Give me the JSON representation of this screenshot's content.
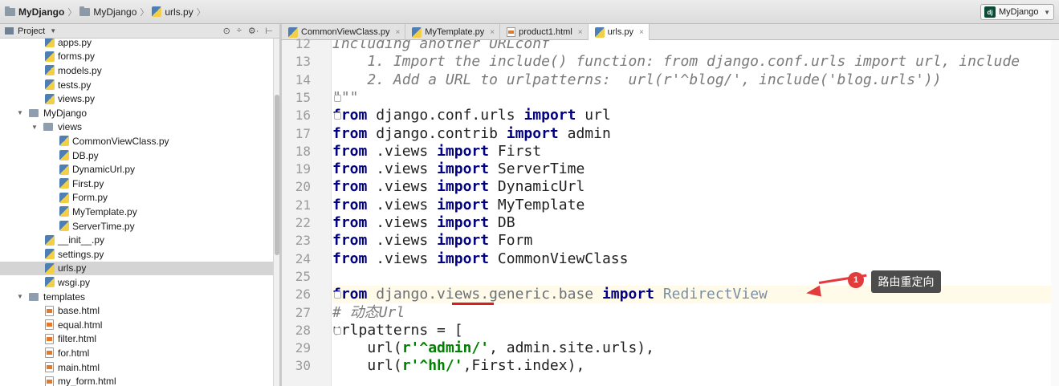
{
  "breadcrumb": {
    "project": "MyDjango",
    "folder": "MyDjango",
    "file": "urls.py"
  },
  "run_config": {
    "icon_text": "dj",
    "label": "MyDjango"
  },
  "project_panel": {
    "title": "Project",
    "tools": [
      "⊙",
      "÷",
      "⚙·",
      "⊢"
    ]
  },
  "tree": [
    {
      "label": "apps.py",
      "type": "py",
      "indent": 2
    },
    {
      "label": "forms.py",
      "type": "py",
      "indent": 2
    },
    {
      "label": "models.py",
      "type": "py",
      "indent": 2
    },
    {
      "label": "tests.py",
      "type": "py",
      "indent": 2
    },
    {
      "label": "views.py",
      "type": "py",
      "indent": 2
    },
    {
      "label": "MyDjango",
      "type": "folder",
      "indent": 1,
      "expanded": true
    },
    {
      "label": "views",
      "type": "folder",
      "indent": 2,
      "expanded": true
    },
    {
      "label": "CommonViewClass.py",
      "type": "py",
      "indent": 3
    },
    {
      "label": "DB.py",
      "type": "py",
      "indent": 3
    },
    {
      "label": "DynamicUrl.py",
      "type": "py",
      "indent": 3
    },
    {
      "label": "First.py",
      "type": "py",
      "indent": 3
    },
    {
      "label": "Form.py",
      "type": "py",
      "indent": 3
    },
    {
      "label": "MyTemplate.py",
      "type": "py",
      "indent": 3
    },
    {
      "label": "ServerTime.py",
      "type": "py",
      "indent": 3
    },
    {
      "label": "__init__.py",
      "type": "py",
      "indent": 2
    },
    {
      "label": "settings.py",
      "type": "py",
      "indent": 2
    },
    {
      "label": "urls.py",
      "type": "py",
      "indent": 2,
      "selected": true
    },
    {
      "label": "wsgi.py",
      "type": "py",
      "indent": 2
    },
    {
      "label": "templates",
      "type": "folder",
      "indent": 1,
      "expanded": true
    },
    {
      "label": "base.html",
      "type": "html",
      "indent": 2
    },
    {
      "label": "equal.html",
      "type": "html",
      "indent": 2
    },
    {
      "label": "filter.html",
      "type": "html",
      "indent": 2
    },
    {
      "label": "for.html",
      "type": "html",
      "indent": 2
    },
    {
      "label": "main.html",
      "type": "html",
      "indent": 2
    },
    {
      "label": "my_form.html",
      "type": "html",
      "indent": 2
    }
  ],
  "tabs": [
    {
      "label": "CommonViewClass.py",
      "type": "py"
    },
    {
      "label": "MyTemplate.py",
      "type": "py"
    },
    {
      "label": "product1.html",
      "type": "html"
    },
    {
      "label": "urls.py",
      "type": "py",
      "active": true
    }
  ],
  "editor": {
    "first_line_partial": "Including another URLconf",
    "line_numbers": [
      "12",
      "13",
      "14",
      "15",
      "16",
      "17",
      "18",
      "19",
      "20",
      "21",
      "22",
      "23",
      "24",
      "25",
      "26",
      "27",
      "28",
      "29",
      "30"
    ],
    "current_line": "26",
    "lines": [
      [
        {
          "t": "Including another URLconf",
          "c": "cm"
        }
      ],
      [
        {
          "t": "    1. Import the include() function: from django.conf.urls import url, include",
          "c": "cm"
        }
      ],
      [
        {
          "t": "    2. Add a URL to urlpatterns:  url(r'^blog/', include('blog.urls'))",
          "c": "cm"
        }
      ],
      [
        {
          "t": "\"\"\"",
          "c": "cm"
        }
      ],
      [
        {
          "t": "from",
          "c": "kw"
        },
        {
          "t": " django.conf.urls ",
          "c": ""
        },
        {
          "t": "import",
          "c": "kw"
        },
        {
          "t": " url",
          "c": ""
        }
      ],
      [
        {
          "t": "from",
          "c": "kw"
        },
        {
          "t": " django.contrib ",
          "c": ""
        },
        {
          "t": "import",
          "c": "kw"
        },
        {
          "t": " admin",
          "c": ""
        }
      ],
      [
        {
          "t": "from",
          "c": "kw"
        },
        {
          "t": " .views ",
          "c": ""
        },
        {
          "t": "import",
          "c": "kw"
        },
        {
          "t": " First",
          "c": ""
        }
      ],
      [
        {
          "t": "from",
          "c": "kw"
        },
        {
          "t": " .views ",
          "c": ""
        },
        {
          "t": "import",
          "c": "kw"
        },
        {
          "t": " ServerTime",
          "c": ""
        }
      ],
      [
        {
          "t": "from",
          "c": "kw"
        },
        {
          "t": " .views ",
          "c": ""
        },
        {
          "t": "import",
          "c": "kw"
        },
        {
          "t": " DynamicUrl",
          "c": ""
        }
      ],
      [
        {
          "t": "from",
          "c": "kw"
        },
        {
          "t": " .views ",
          "c": ""
        },
        {
          "t": "import",
          "c": "kw"
        },
        {
          "t": " MyTemplate",
          "c": ""
        }
      ],
      [
        {
          "t": "from",
          "c": "kw"
        },
        {
          "t": " .views ",
          "c": ""
        },
        {
          "t": "import",
          "c": "kw"
        },
        {
          "t": " DB",
          "c": ""
        }
      ],
      [
        {
          "t": "from",
          "c": "kw"
        },
        {
          "t": " .views ",
          "c": ""
        },
        {
          "t": "import",
          "c": "kw"
        },
        {
          "t": " Form",
          "c": ""
        }
      ],
      [
        {
          "t": "from",
          "c": "kw"
        },
        {
          "t": " .views ",
          "c": ""
        },
        {
          "t": "import",
          "c": "kw"
        },
        {
          "t": " CommonViewClass",
          "c": ""
        }
      ],
      [],
      [
        {
          "t": "from",
          "c": "kw"
        },
        {
          "t": " django.views.generic.base ",
          "c": "dim"
        },
        {
          "t": "import",
          "c": "kw"
        },
        {
          "t": " ",
          "c": ""
        },
        {
          "t": "RedirectView",
          "c": "unused"
        }
      ],
      [
        {
          "t": "# 动态Url",
          "c": "cm"
        }
      ],
      [
        {
          "t": "urlpatterns = [",
          "c": ""
        }
      ],
      [
        {
          "t": "    url(",
          "c": ""
        },
        {
          "t": "r'^admin/'",
          "c": "st"
        },
        {
          "t": ", admin.site.urls),",
          "c": ""
        }
      ],
      [
        {
          "t": "    url(",
          "c": ""
        },
        {
          "t": "r'^hh/'",
          "c": "st"
        },
        {
          "t": ",First.index),",
          "c": ""
        }
      ]
    ]
  },
  "annotation": {
    "badge_number": "1",
    "callout_text": "路由重定向",
    "color": "#e23b3b"
  }
}
